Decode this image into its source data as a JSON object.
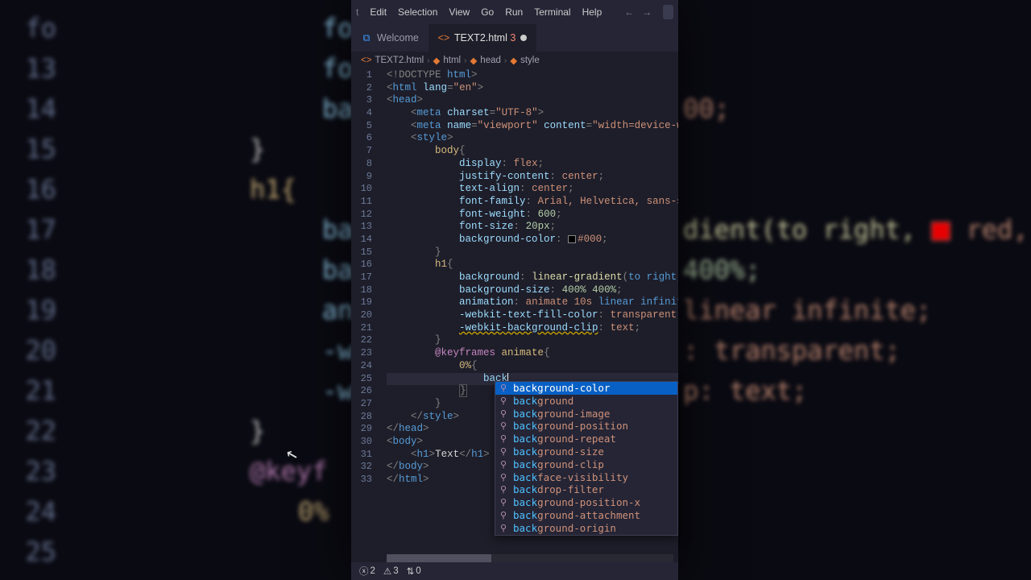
{
  "menubar": {
    "items": [
      "Edit",
      "Selection",
      "View",
      "Go",
      "Run",
      "Terminal",
      "Help"
    ]
  },
  "tabs": [
    {
      "label": "Welcome",
      "active": false
    },
    {
      "label": "TEXT2.html",
      "active": true,
      "problems": 3,
      "dirty": true
    }
  ],
  "breadcrumbs": [
    "TEXT2.html",
    "html",
    "head",
    "style"
  ],
  "gutter_lines": [
    "1",
    "2",
    "3",
    "4",
    "5",
    "6",
    "7",
    "8",
    "9",
    "10",
    "11",
    "12",
    "13",
    "14",
    "15",
    "16",
    "17",
    "18",
    "19",
    "20",
    "21",
    "22",
    "23",
    "24",
    "25",
    "26",
    "27",
    "28",
    "29",
    "30",
    "31",
    "32",
    "33"
  ],
  "code": {
    "l1": {
      "doctype": "<!DOCTYPE",
      "html": "html",
      "close": ">"
    },
    "l2": {
      "open": "<html",
      "attr": "lang",
      "eq": "=",
      "val": "\"en\"",
      "close": ">"
    },
    "l3": "<head>",
    "l4": {
      "open": "<meta",
      "attr": "charset",
      "eq": "=",
      "val": "\"UTF-8\"",
      "close": ">"
    },
    "l5": {
      "open": "<meta",
      "attr1": "name",
      "val1": "\"viewport\"",
      "attr2": "content",
      "val2": "\"width=device-width, i"
    },
    "l6": "<style>",
    "l7": "body{",
    "l8": {
      "prop": "display",
      "val": "flex"
    },
    "l9": {
      "prop": "justify-content",
      "val": "center"
    },
    "l10": {
      "prop": "text-align",
      "val": "center"
    },
    "l11": {
      "prop": "font-family",
      "val": "Arial, Helvetica, sans-serif"
    },
    "l12": {
      "prop": "font-weight",
      "val": "600"
    },
    "l13": {
      "prop": "font-size",
      "val": "20px"
    },
    "l14": {
      "prop": "background-color",
      "swatch": "#000",
      "val": "#000"
    },
    "l15": "}",
    "l16": "h1{",
    "l17": {
      "prop": "background",
      "fn": "linear-gradient",
      "args_open": "(",
      "arg1": "to right",
      "comma": ", ",
      "swatch": "#f00",
      "arg2": "red,"
    },
    "l18": {
      "prop": "background-size",
      "val": "400% 400%"
    },
    "l19": {
      "prop": "animation",
      "val": "animate 10s",
      "kw": "linear infinite"
    },
    "l20": {
      "prop": "-webkit-text-fill-color",
      "val": "transparent"
    },
    "l21": {
      "prop": "-webkit-background-clip",
      "val": "text"
    },
    "l22": "}",
    "l23": {
      "kw": "@keyframes",
      "name": "animate",
      "brace": "{"
    },
    "l24": "0%{",
    "l25": "back",
    "l26": "}",
    "l27": "}",
    "l28": "</style>",
    "l29": "</head>",
    "l30": "<body>",
    "l31": {
      "open": "<h1>",
      "text": "Text",
      "close": "</h1>"
    },
    "l32": "</body>",
    "l33": "</html>"
  },
  "autocomplete": {
    "typed": "back",
    "items": [
      "background-color",
      "background",
      "background-image",
      "background-position",
      "background-repeat",
      "background-size",
      "background-clip",
      "backface-visibility",
      "backdrop-filter",
      "background-position-x",
      "background-attachment",
      "background-origin"
    ],
    "selected": 0
  },
  "status": {
    "errors": "2",
    "warnings": "3",
    "ports": "0"
  },
  "bg_lines": {
    "12": "fo",
    "13": "fo",
    "14": "ba",
    "15": "}",
    "16": "h1{",
    "17": "ba",
    "18": "ba",
    "19": "an",
    "20": "-w",
    "21": "-w",
    "22": "}",
    "23": "@keyf",
    "24": "0%",
    "25": ""
  },
  "bg_right": {
    "r14": "00;",
    "r17": "dient(to right, ",
    "r17b": "red,",
    "r18": "400%;",
    "r19": "linear infinite;",
    "r20": ": transparent;",
    "r21": "p: text;"
  }
}
